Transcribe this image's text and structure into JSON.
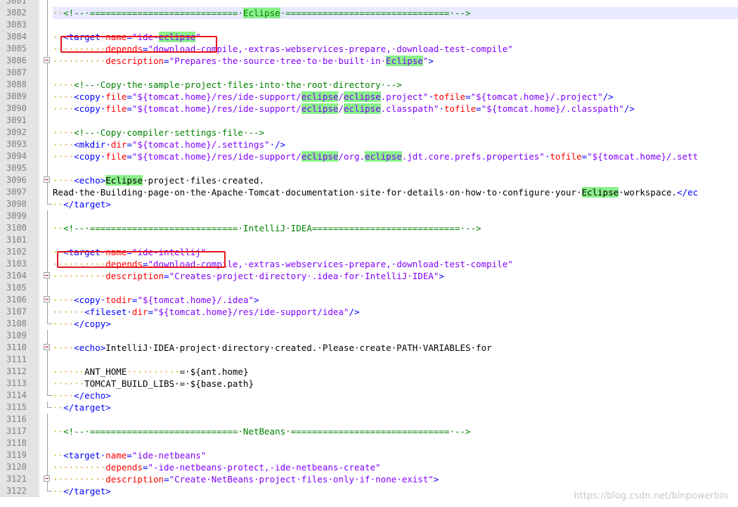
{
  "editor": {
    "lines": [
      {
        "n": "3081",
        "fold": "line",
        "indent": 0,
        "segs": []
      },
      {
        "n": "3082",
        "fold": "line",
        "hl": true,
        "segs": [
          [
            "ws",
            "··"
          ],
          [
            "c",
            "<!--·============================·"
          ],
          [
            "ck",
            "Eclipse"
          ],
          [
            "c",
            "·===============================·-->"
          ]
        ]
      },
      {
        "n": "3083",
        "fold": "line",
        "segs": []
      },
      {
        "n": "3084",
        "fold": "line",
        "segs": [
          [
            "ws",
            "··"
          ],
          [
            "t",
            "<target·"
          ],
          [
            "a",
            "name"
          ],
          [
            "t",
            "="
          ],
          [
            "v",
            "\"ide-"
          ],
          [
            "vk",
            "eclipse"
          ],
          [
            "v",
            "\""
          ]
        ]
      },
      {
        "n": "3085",
        "fold": "line",
        "segs": [
          [
            "ws",
            "··········"
          ],
          [
            "a",
            "depends"
          ],
          [
            "t",
            "="
          ],
          [
            "v",
            "\"download-compile,·extras-webservices-prepare,·download-test-compile\""
          ]
        ]
      },
      {
        "n": "3086",
        "fold": "box",
        "segs": [
          [
            "ws",
            "··········"
          ],
          [
            "a",
            "description"
          ],
          [
            "t",
            "="
          ],
          [
            "v",
            "\"Prepares·the·source·tree·to·be·built·in·"
          ],
          [
            "vk",
            "Eclipse"
          ],
          [
            "v",
            "\""
          ],
          [
            "t",
            ">"
          ]
        ]
      },
      {
        "n": "3087",
        "fold": "line",
        "segs": []
      },
      {
        "n": "3088",
        "fold": "line",
        "segs": [
          [
            "ws",
            "····"
          ],
          [
            "c",
            "<!--·Copy·the·sample·project·files·into·the·root·directory·-->"
          ]
        ]
      },
      {
        "n": "3089",
        "fold": "line",
        "segs": [
          [
            "ws",
            "····"
          ],
          [
            "t",
            "<copy·"
          ],
          [
            "a",
            "file"
          ],
          [
            "t",
            "="
          ],
          [
            "v",
            "\"${tomcat.home}/res/ide-support/"
          ],
          [
            "vk",
            "eclipse"
          ],
          [
            "v",
            "/"
          ],
          [
            "vk",
            "eclipse"
          ],
          [
            "v",
            ".project\""
          ],
          [
            "t",
            "·"
          ],
          [
            "a",
            "tofile"
          ],
          [
            "t",
            "="
          ],
          [
            "v",
            "\"${tomcat.home}/.project\""
          ],
          [
            "t",
            "/>"
          ]
        ]
      },
      {
        "n": "3090",
        "fold": "line",
        "segs": [
          [
            "ws",
            "····"
          ],
          [
            "t",
            "<copy·"
          ],
          [
            "a",
            "file"
          ],
          [
            "t",
            "="
          ],
          [
            "v",
            "\"${tomcat.home}/res/ide-support/"
          ],
          [
            "vk",
            "eclipse"
          ],
          [
            "v",
            "/"
          ],
          [
            "vk",
            "eclipse"
          ],
          [
            "v",
            ".classpath\""
          ],
          [
            "t",
            "·"
          ],
          [
            "a",
            "tofile"
          ],
          [
            "t",
            "="
          ],
          [
            "v",
            "\"${tomcat.home}/.classpath\""
          ],
          [
            "t",
            "/>"
          ]
        ]
      },
      {
        "n": "3091",
        "fold": "line",
        "segs": []
      },
      {
        "n": "3092",
        "fold": "line",
        "segs": [
          [
            "ws",
            "····"
          ],
          [
            "c",
            "<!--·Copy·compiler·settings·file·-->"
          ]
        ]
      },
      {
        "n": "3093",
        "fold": "line",
        "segs": [
          [
            "ws",
            "····"
          ],
          [
            "t",
            "<mkdir·"
          ],
          [
            "a",
            "dir"
          ],
          [
            "t",
            "="
          ],
          [
            "v",
            "\"${tomcat.home}/.settings\""
          ],
          [
            "t",
            "·/>"
          ]
        ]
      },
      {
        "n": "3094",
        "fold": "line",
        "segs": [
          [
            "ws",
            "····"
          ],
          [
            "t",
            "<copy·"
          ],
          [
            "a",
            "file"
          ],
          [
            "t",
            "="
          ],
          [
            "v",
            "\"${tomcat.home}/res/ide-support/"
          ],
          [
            "vk",
            "eclipse"
          ],
          [
            "v",
            "/org."
          ],
          [
            "vk",
            "eclipse"
          ],
          [
            "v",
            ".jdt.core.prefs.properties\""
          ],
          [
            "t",
            "·"
          ],
          [
            "a",
            "tofile"
          ],
          [
            "t",
            "="
          ],
          [
            "v",
            "\"${tomcat.home}/.sett"
          ]
        ]
      },
      {
        "n": "3095",
        "fold": "line",
        "segs": []
      },
      {
        "n": "3096",
        "fold": "box",
        "segs": [
          [
            "ws",
            "····"
          ],
          [
            "t",
            "<echo>"
          ],
          [
            "xk",
            "Eclipse"
          ],
          [
            "x",
            "·project·files·created."
          ]
        ]
      },
      {
        "n": "3097",
        "fold": "line",
        "segs": [
          [
            "x",
            "Read·the·Building·page·on·the·Apache·Tomcat·documentation·site·for·details·on·how·to·configure·your·"
          ],
          [
            "xk",
            "Eclipse"
          ],
          [
            "x",
            "·workspace."
          ],
          [
            "t",
            "</ec"
          ]
        ]
      },
      {
        "n": "3098",
        "fold": "end",
        "segs": [
          [
            "ws",
            "··"
          ],
          [
            "t",
            "</target>"
          ]
        ]
      },
      {
        "n": "3099",
        "fold": "line",
        "segs": []
      },
      {
        "n": "3100",
        "fold": "line",
        "segs": [
          [
            "ws",
            "··"
          ],
          [
            "c",
            "<!--·============================·IntelliJ·IDEA============================·-->"
          ]
        ]
      },
      {
        "n": "3101",
        "fold": "line",
        "segs": []
      },
      {
        "n": "3102",
        "fold": "line",
        "segs": [
          [
            "ws",
            "··"
          ],
          [
            "t",
            "<target·"
          ],
          [
            "a",
            "name"
          ],
          [
            "t",
            "="
          ],
          [
            "v",
            "\"ide-intellij\""
          ]
        ]
      },
      {
        "n": "3103",
        "fold": "line",
        "segs": [
          [
            "ws",
            "··········"
          ],
          [
            "a",
            "depends"
          ],
          [
            "t",
            "="
          ],
          [
            "v",
            "\"download-compile,·extras-webservices-prepare,·download-test-compile\""
          ]
        ]
      },
      {
        "n": "3104",
        "fold": "box",
        "segs": [
          [
            "ws",
            "··········"
          ],
          [
            "a",
            "description"
          ],
          [
            "t",
            "="
          ],
          [
            "v",
            "\"Creates·project·directory·.idea·for·IntelliJ·IDEA\""
          ],
          [
            "t",
            ">"
          ]
        ]
      },
      {
        "n": "3105",
        "fold": "line",
        "segs": []
      },
      {
        "n": "3106",
        "fold": "box",
        "segs": [
          [
            "ws",
            "····"
          ],
          [
            "t",
            "<copy·"
          ],
          [
            "a",
            "todir"
          ],
          [
            "t",
            "="
          ],
          [
            "v",
            "\"${tomcat.home}/.idea\""
          ],
          [
            "t",
            ">"
          ]
        ]
      },
      {
        "n": "3107",
        "fold": "line",
        "segs": [
          [
            "ws",
            "······"
          ],
          [
            "t",
            "<fileset·"
          ],
          [
            "a",
            "dir"
          ],
          [
            "t",
            "="
          ],
          [
            "v",
            "\"${tomcat.home}/res/ide-support/idea\""
          ],
          [
            "t",
            "/>"
          ]
        ]
      },
      {
        "n": "3108",
        "fold": "end",
        "segs": [
          [
            "ws",
            "····"
          ],
          [
            "t",
            "</copy>"
          ]
        ]
      },
      {
        "n": "3109",
        "fold": "line",
        "segs": []
      },
      {
        "n": "3110",
        "fold": "box",
        "segs": [
          [
            "ws",
            "····"
          ],
          [
            "t",
            "<echo>"
          ],
          [
            "x",
            "IntelliJ·IDEA·project·directory·created.·Please·create·PATH·VARIABLES·for"
          ]
        ]
      },
      {
        "n": "3111",
        "fold": "line",
        "segs": []
      },
      {
        "n": "3112",
        "fold": "line",
        "segs": [
          [
            "ws",
            "······"
          ],
          [
            "x",
            "ANT_HOME"
          ],
          [
            "ws",
            "··········"
          ],
          [
            "x",
            "=·${ant.home}"
          ]
        ]
      },
      {
        "n": "3113",
        "fold": "line",
        "segs": [
          [
            "ws",
            "······"
          ],
          [
            "x",
            "TOMCAT_BUILD_LIBS·=·${base.path}"
          ]
        ]
      },
      {
        "n": "3114",
        "fold": "end",
        "segs": [
          [
            "ws",
            "····"
          ],
          [
            "t",
            "</echo>"
          ]
        ]
      },
      {
        "n": "3115",
        "fold": "end",
        "segs": [
          [
            "ws",
            "··"
          ],
          [
            "t",
            "</target>"
          ]
        ]
      },
      {
        "n": "3116",
        "fold": "line",
        "segs": []
      },
      {
        "n": "3117",
        "fold": "line",
        "segs": [
          [
            "ws",
            "··"
          ],
          [
            "c",
            "<!--·============================·NetBeans·==============================·-->"
          ]
        ]
      },
      {
        "n": "3118",
        "fold": "line",
        "segs": []
      },
      {
        "n": "3119",
        "fold": "line",
        "segs": [
          [
            "ws",
            "··"
          ],
          [
            "t",
            "<target·"
          ],
          [
            "a",
            "name"
          ],
          [
            "t",
            "="
          ],
          [
            "v",
            "\"ide-netbeans\""
          ]
        ]
      },
      {
        "n": "3120",
        "fold": "line",
        "segs": [
          [
            "ws",
            "··········"
          ],
          [
            "a",
            "depends"
          ],
          [
            "t",
            "="
          ],
          [
            "v",
            "\"-ide-netbeans-protect,-ide-netbeans-create\""
          ]
        ]
      },
      {
        "n": "3121",
        "fold": "box",
        "segs": [
          [
            "ws",
            "··········"
          ],
          [
            "a",
            "description"
          ],
          [
            "t",
            "="
          ],
          [
            "v",
            "\"Create·NetBeans·project·files·only·if·none·exist\""
          ],
          [
            "t",
            ">"
          ]
        ]
      },
      {
        "n": "3122",
        "fold": "end",
        "segs": [
          [
            "ws",
            "··"
          ],
          [
            "t",
            "</target>"
          ]
        ]
      }
    ]
  },
  "watermark": "https://blog.csdn.net/binpowerbin",
  "colors": {
    "tag": "#0000ff",
    "attribute": "#ff0000",
    "value": "#8000ff",
    "comment": "#008000",
    "highlight": "#8af08a",
    "annotation_box": "#e8141c"
  }
}
